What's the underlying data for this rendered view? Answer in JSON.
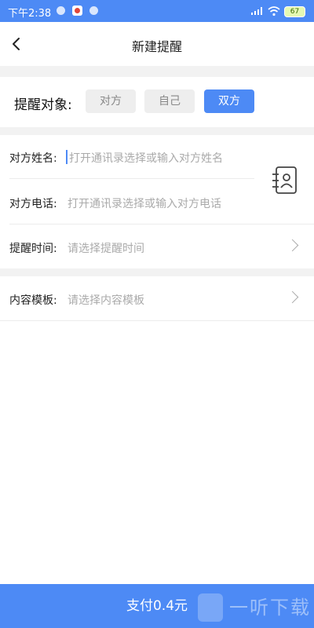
{
  "status": {
    "time": "下午2:38",
    "battery": "67"
  },
  "header": {
    "title": "新建提醒"
  },
  "target": {
    "label": "提醒对象:",
    "options": [
      "对方",
      "自己",
      "双方"
    ],
    "selected": "双方"
  },
  "fields": {
    "name": {
      "label": "对方姓名:",
      "placeholder": "打开通讯录选择或输入对方姓名"
    },
    "phone": {
      "label": "对方电话:",
      "placeholder": "打开通讯录选择或输入对方电话"
    },
    "time": {
      "label": "提醒时间:",
      "placeholder": "请选择提醒时间"
    },
    "template": {
      "label": "内容模板:",
      "placeholder": "请选择内容模板"
    }
  },
  "footer": {
    "pay_label": "支付0.4元",
    "watermark": "一听下载"
  },
  "colors": {
    "accent": "#4d8af5",
    "background_gap": "#f2f2f2"
  }
}
